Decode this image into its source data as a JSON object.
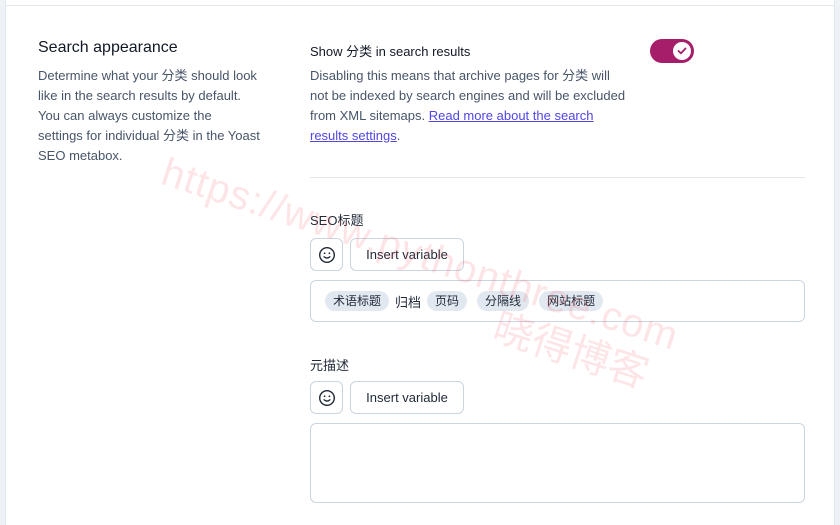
{
  "section": {
    "title": "Search appearance",
    "description": "Determine what your 分类 should look like in the search results by default. You can always customize the settings for individual 分类 in the Yoast SEO metabox."
  },
  "show_in_results": {
    "label": "Show 分类 in search results",
    "enabled": true,
    "description": "Disabling this means that archive pages for 分类 will not be indexed by search engines and will be excluded from XML sitemaps. ",
    "link_text": "Read more about the search results settings",
    "trailing": ".",
    "accent_color": "#a61e69"
  },
  "seo_title": {
    "label": "SEO标题",
    "emoji_icon": "smiley-icon",
    "insert_variable_label": "Insert variable",
    "tokens": [
      {
        "type": "chip",
        "text": "术语标题"
      },
      {
        "type": "text",
        "text": "归档"
      },
      {
        "type": "chip",
        "text": "页码"
      },
      {
        "type": "chip",
        "text": "分隔线"
      },
      {
        "type": "chip",
        "text": "网站标题"
      }
    ]
  },
  "meta_description": {
    "label": "元描述",
    "emoji_icon": "smiley-icon",
    "insert_variable_label": "Insert variable",
    "value": ""
  },
  "watermark": {
    "url": "https://www.pythonthree.com",
    "name": "晓得博客"
  }
}
